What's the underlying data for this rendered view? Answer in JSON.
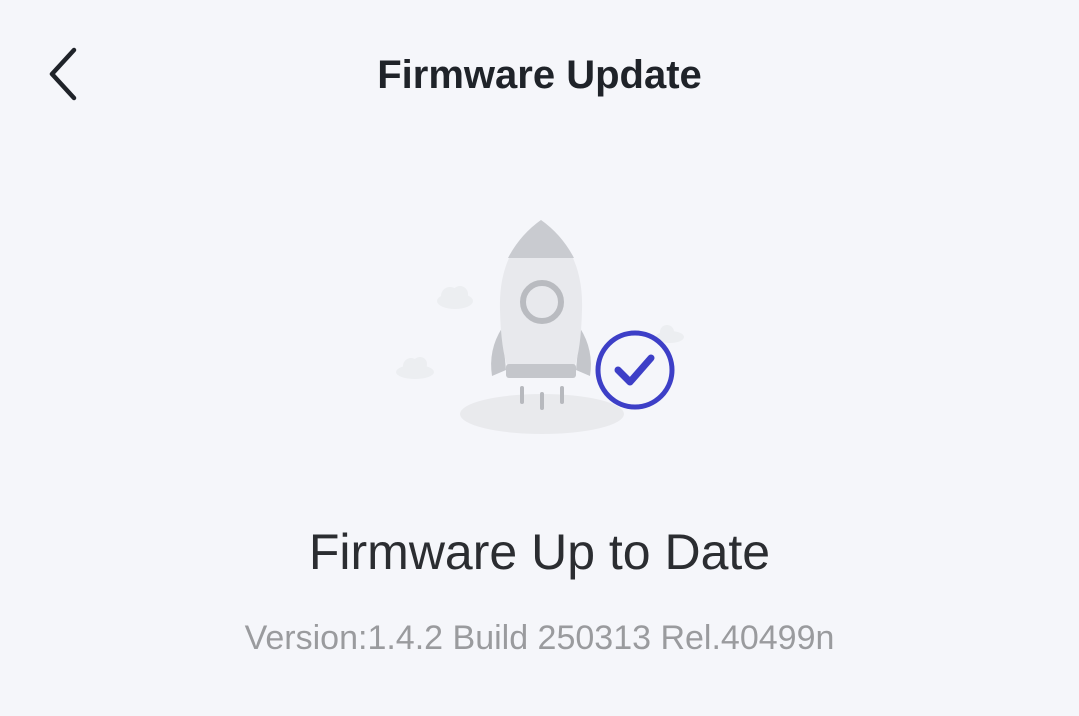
{
  "header": {
    "back_icon": "chevron-left-icon",
    "title": "Firmware Update"
  },
  "illustration": {
    "icon": "rocket-icon",
    "badge_icon": "check-circle-icon",
    "colors": {
      "rocket": "#e9eaee",
      "rocket_shade": "#c4c6cb",
      "check": "#3d3fc7",
      "cloud": "#eceef1"
    }
  },
  "status": {
    "title": "Firmware Up to Date",
    "version": "Version:1.4.2 Build 250313 Rel.40499n"
  }
}
